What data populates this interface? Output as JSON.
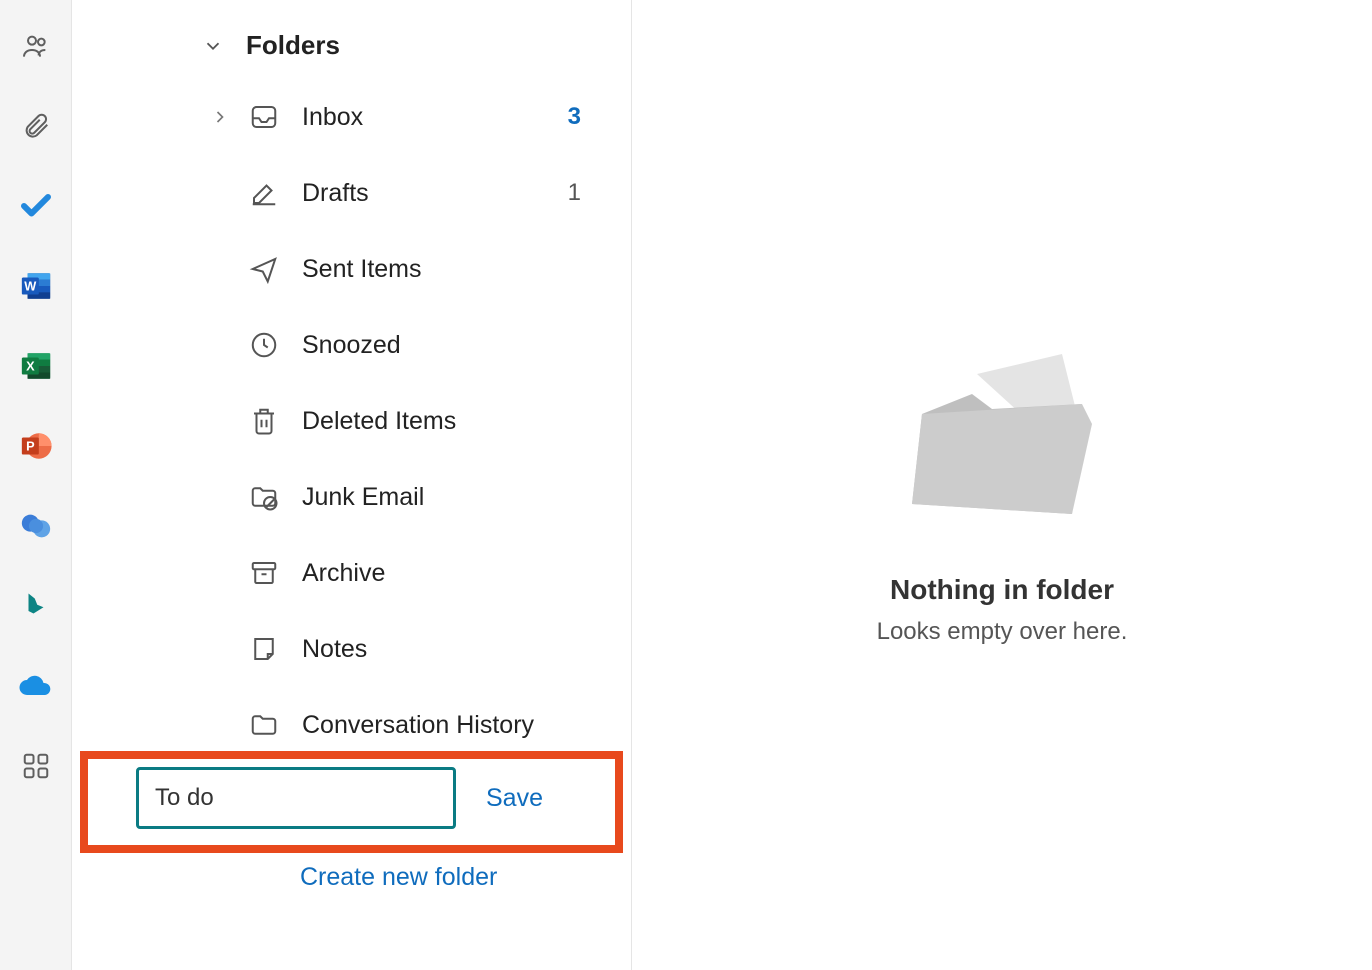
{
  "apprail": {
    "items": [
      {
        "name": "people-icon"
      },
      {
        "name": "attachments-icon"
      },
      {
        "name": "todo-icon"
      },
      {
        "name": "word-icon"
      },
      {
        "name": "excel-icon"
      },
      {
        "name": "powerpoint-icon"
      },
      {
        "name": "viva-icon"
      },
      {
        "name": "bing-icon"
      },
      {
        "name": "onedrive-icon"
      },
      {
        "name": "apps-icon"
      }
    ]
  },
  "sidebar": {
    "folders_label": "Folders",
    "items": [
      {
        "label": "Inbox",
        "icon": "inbox-icon",
        "count": "3",
        "unread": true,
        "expandable": true
      },
      {
        "label": "Drafts",
        "icon": "drafts-icon",
        "count": "1",
        "unread": false
      },
      {
        "label": "Sent Items",
        "icon": "sent-icon"
      },
      {
        "label": "Snoozed",
        "icon": "snoozed-icon"
      },
      {
        "label": "Deleted Items",
        "icon": "deleted-icon"
      },
      {
        "label": "Junk Email",
        "icon": "junk-icon"
      },
      {
        "label": "Archive",
        "icon": "archive-icon"
      },
      {
        "label": "Notes",
        "icon": "notes-icon"
      },
      {
        "label": "Conversation History",
        "icon": "folder-icon"
      }
    ],
    "new_folder_value": "To do",
    "save_label": "Save",
    "create_new_label": "Create new folder"
  },
  "content": {
    "empty_title": "Nothing in folder",
    "empty_subtitle": "Looks empty over here."
  }
}
